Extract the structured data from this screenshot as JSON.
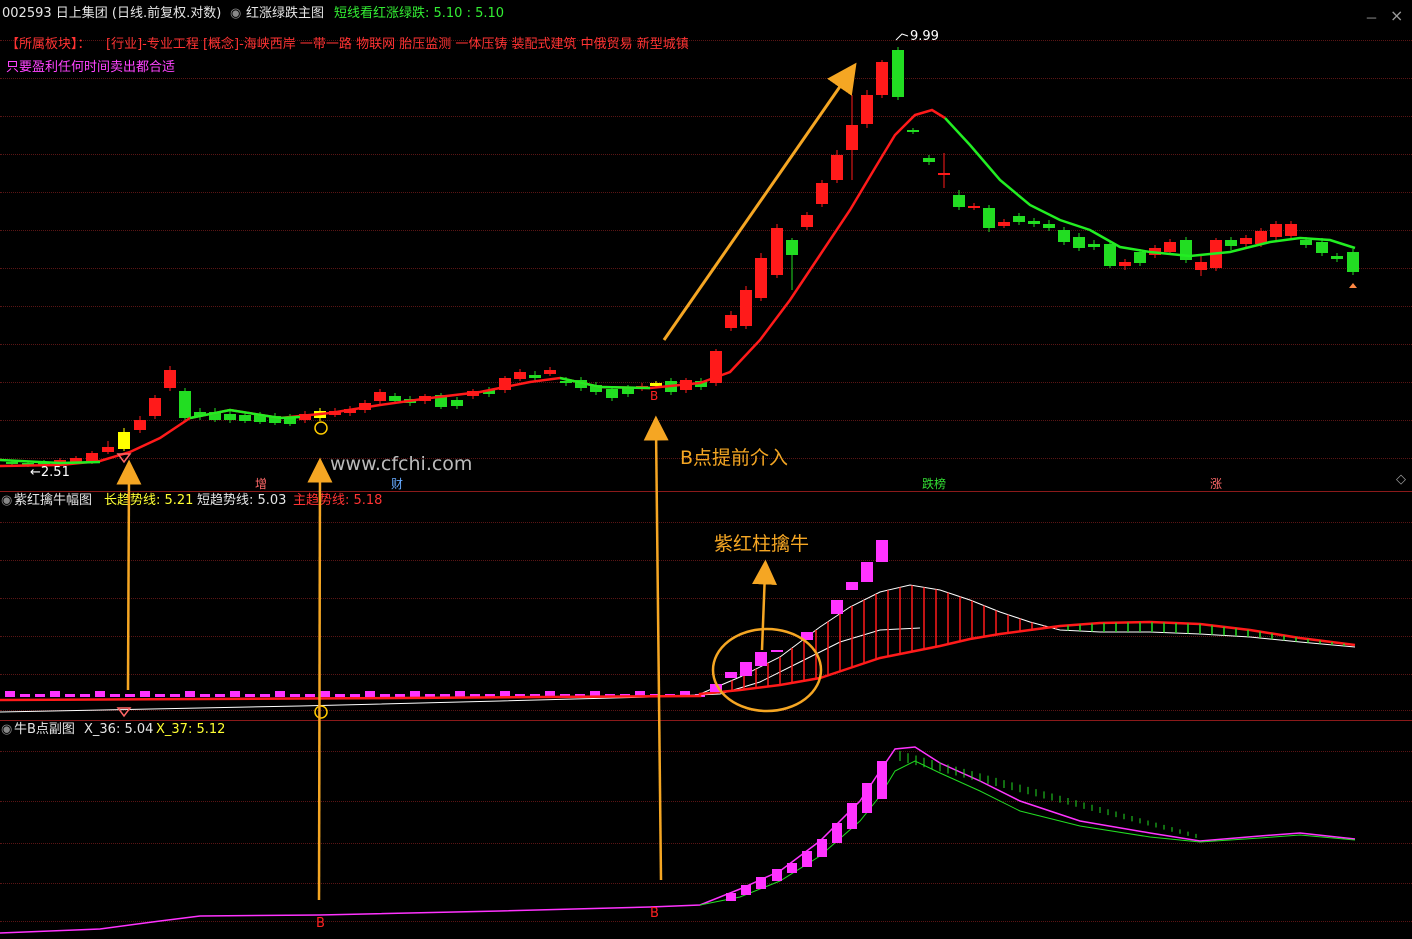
{
  "header": {
    "stock": "002593 日上集团 (日线.前复权.对数)",
    "indicator": "红涨绿跌主图",
    "value_text": "短线看红涨绿跌: 5.10 : 5.10",
    "sector_tag": "【所属板块】：",
    "sectors": "[行业]-专业工程 [概念]-海峡西岸 一带一路 物联网 胎压监测 一体压铸 装配式建筑 中俄贸易 新型城镇",
    "note": "只要盈利任何时间卖出都合适"
  },
  "main_chart": {
    "high_label": "9.99",
    "low_label": "←2.51",
    "b_marker": "B",
    "events": [
      {
        "label": "增",
        "color": "#ff6a6a"
      },
      {
        "label": "财",
        "color": "#66aaff"
      },
      {
        "label": "跌榜",
        "color": "#33dd33"
      },
      {
        "label": "涨",
        "color": "#ff6a6a"
      }
    ]
  },
  "sub1": {
    "title": "紫红擒牛幅图",
    "long": "长趋势线: 5.21",
    "short": "短趋势线: 5.03",
    "main": "主趋势线: 5.18"
  },
  "sub2": {
    "title": "牛B点副图",
    "x36": "X_36: 5.04",
    "x37": "X_37: 5.12",
    "b_marker": "B"
  },
  "annotations": {
    "watermark": "www.cfchi.com",
    "b_early": "B点提前介入",
    "purple_bar": "紫红柱擒牛"
  },
  "window_controls": {
    "minimize": "－",
    "close": "×",
    "settings": "◇"
  },
  "colors": {
    "up": "#ff1a1a",
    "down": "#22dd22",
    "accent": "#f5a623",
    "magenta": "#ff33ff",
    "yellow": "#ffff00"
  }
}
